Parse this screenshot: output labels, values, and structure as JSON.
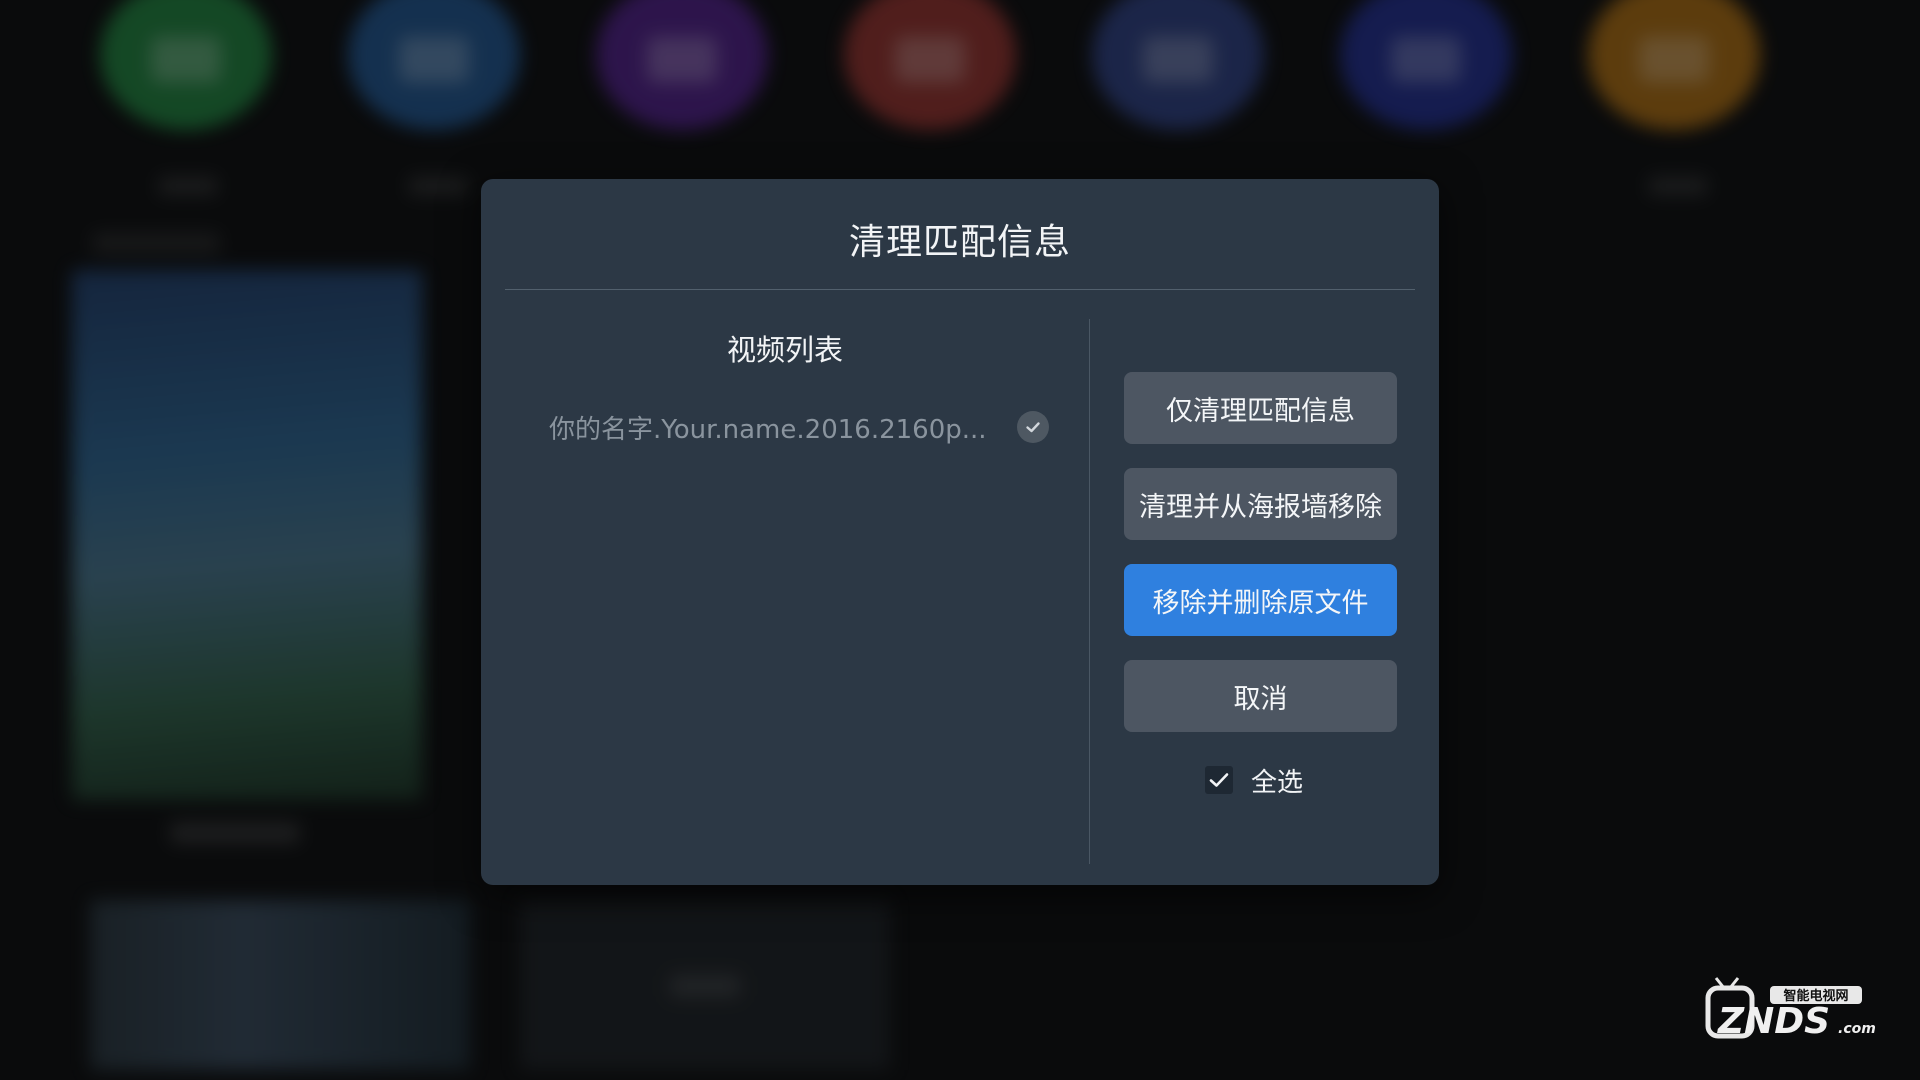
{
  "background": {
    "icon_colors": [
      "#1d7a3a",
      "#1d4f86",
      "#4a1d80",
      "#8a2e2a",
      "#2a3b7a",
      "#1e2a86",
      "#a0650f"
    ]
  },
  "dialog": {
    "title": "清理匹配信息",
    "list": {
      "title": "视频列表",
      "items": [
        {
          "label": "你的名字.Your.name.2016.2160p...",
          "checked": true
        }
      ]
    },
    "actions": {
      "clean_only": "仅清理匹配信息",
      "clean_and_remove": "清理并从海报墙移除",
      "remove_and_delete": "移除并删除原文件",
      "cancel": "取消"
    },
    "select_all": {
      "label": "全选",
      "checked": true
    },
    "colors": {
      "panel": "#2c3845",
      "button": "#4d5662",
      "primary": "#2f80df"
    }
  },
  "watermark": {
    "brand": "ZNDS",
    "suffix": ".com",
    "tagline": "智能电视网"
  }
}
